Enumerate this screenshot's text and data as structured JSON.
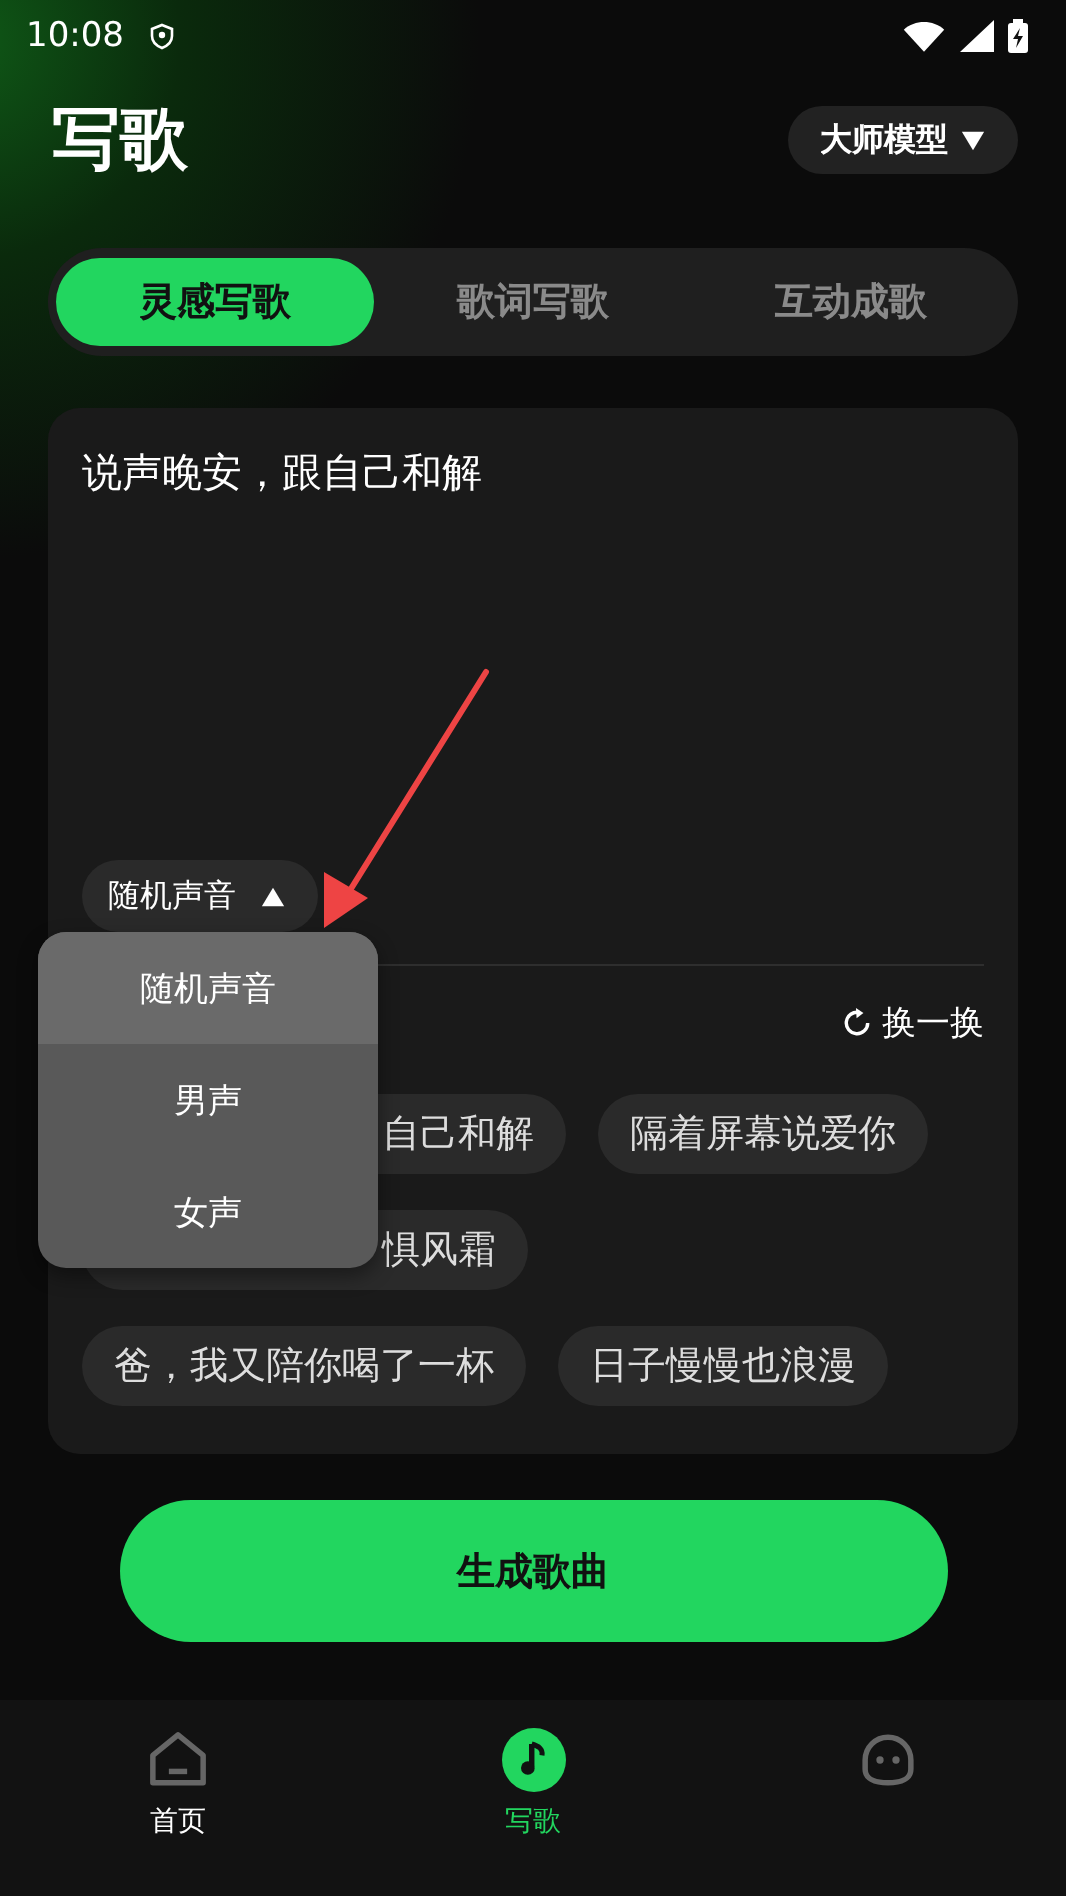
{
  "status_bar": {
    "time": "10:08"
  },
  "header": {
    "title": "写歌",
    "model_button": "大师模型"
  },
  "tabs": [
    {
      "label": "灵感写歌",
      "selected": true
    },
    {
      "label": "歌词写歌",
      "selected": false
    },
    {
      "label": "互动成歌",
      "selected": false
    }
  ],
  "prompt": {
    "value": "说声晚安，跟自己和解"
  },
  "voice_button": {
    "label": "随机声音",
    "expanded": true
  },
  "voice_menu": [
    {
      "label": "随机声音",
      "selected": true
    },
    {
      "label": "男声",
      "selected": false
    },
    {
      "label": "女声",
      "selected": false
    }
  ],
  "refresh_button": "换一换",
  "suggestion_rows": [
    {
      "chips": [
        {
          "text": "自己和解",
          "kind": "partial"
        },
        {
          "text": "隔着屏幕说爱你",
          "kind": "full"
        }
      ]
    },
    {
      "chips": [
        {
          "text": "惧风霜",
          "kind": "partial"
        }
      ]
    },
    {
      "chips": [
        {
          "text": "爸，我又陪你喝了一杯",
          "kind": "full"
        },
        {
          "text": "日子慢慢也浪漫",
          "kind": "full"
        }
      ]
    }
  ],
  "generate_button": "生成歌曲",
  "bottom_nav": [
    {
      "label": "首页",
      "kind": "home",
      "selected": false
    },
    {
      "label": "写歌",
      "kind": "music",
      "selected": true
    },
    {
      "kind": "face",
      "selected": false
    }
  ]
}
